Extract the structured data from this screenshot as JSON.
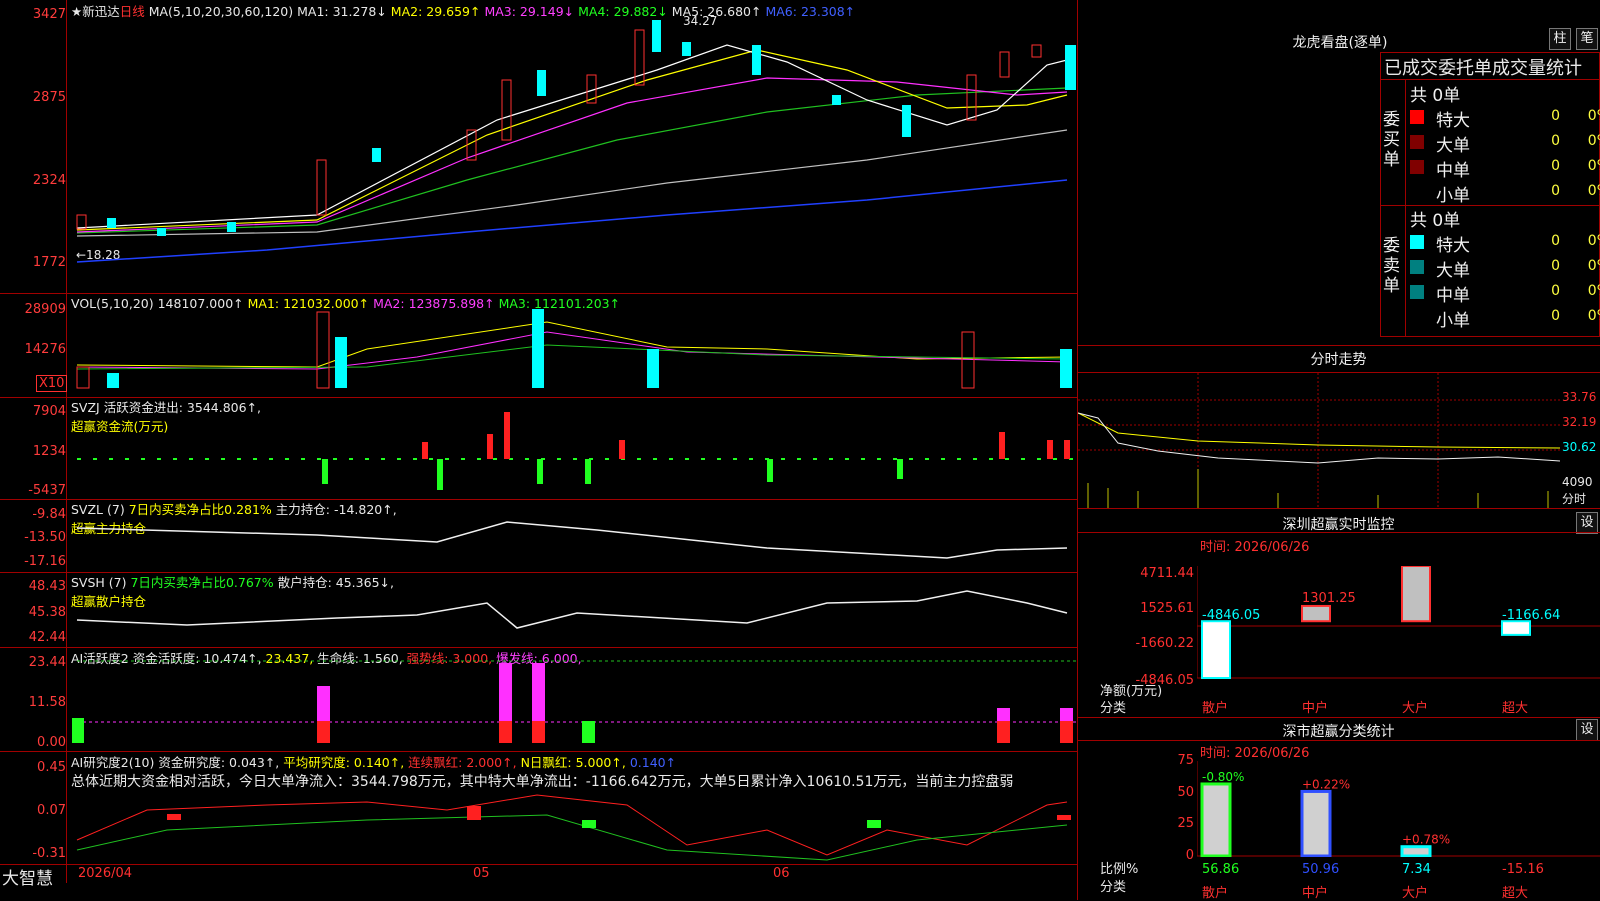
{
  "main_chart": {
    "title": "★新迅达",
    "period": "日线",
    "ma_params": "MA(5,10,20,30,60,120)",
    "ma": [
      {
        "t": "MA1: 31.278↓",
        "c": "w"
      },
      {
        "t": "MA2: 29.659↑",
        "c": "y"
      },
      {
        "t": "MA3: 29.149↓",
        "c": "m"
      },
      {
        "t": "MA4: 29.882↓",
        "c": "g"
      },
      {
        "t": "MA5: 26.680↑",
        "c": "w"
      },
      {
        "t": "MA6: 23.308↑",
        "c": "b"
      }
    ],
    "high_label": "34.27",
    "low_label": "←18.28",
    "axis": [
      "3427",
      "2875",
      "2324",
      "1772"
    ]
  },
  "vol": {
    "title": "VOL(5,10,20)",
    "value": "148107.000↑",
    "ma1": "MA1: 121032.000↑",
    "ma2": "MA2: 123875.898↑",
    "ma3": "MA3: 112101.203↑",
    "axis": [
      "28909",
      "14276"
    ],
    "unit": "X10"
  },
  "svzj": {
    "title": "SVZJ",
    "label": "活跃资金进出: 3544.806↑,",
    "sub": "超赢资金流(万元)",
    "axis": [
      "7904",
      "1234",
      "-5437"
    ]
  },
  "svzl": {
    "title": "SVZL (7)",
    "pct": "7日内买卖净占比0.281%",
    "hold": "主力持仓: -14.820↑,",
    "sub": "超赢主力持仓",
    "axis": [
      "-9.84",
      "-13.50",
      "-17.16"
    ]
  },
  "svsh": {
    "title": "SVSH (7)",
    "pct": "7日内买卖净占比0.767%",
    "hold": "散户持仓: 45.365↓,",
    "sub": "超赢散户持仓",
    "axis": [
      "48.43",
      "45.38",
      "42.44"
    ]
  },
  "ai1": {
    "title": "AI活跃度2",
    "a": "资金活跃度: 10.474↑,",
    "b": "23.437,",
    "c": "生命线: 1.560,",
    "d": "强势线: 3.000,",
    "e": "爆发线: 6.000,",
    "axis": [
      "23.44",
      "11.58",
      "0.00"
    ]
  },
  "ai2": {
    "title": "AI研究度2(10)",
    "a": "资金研究度: 0.043↑,",
    "b": "平均研究度: 0.140↑,",
    "c": "连续飘红: 2.000↑,",
    "d": "N日飘红: 5.000↑,",
    "e": "0.140↑",
    "note": "总体近期大资金相对活跃，今日大单净流入：3544.798万元，其中特大单净流出：-1166.642万元，大单5日累计净入10610.51万元，当前主力控盘弱",
    "axis": [
      "0.45",
      "0.07",
      "-0.31"
    ]
  },
  "footer": {
    "brand": "大智慧",
    "d1": "2026/04",
    "d2": "05",
    "d3": "06"
  },
  "lhb": {
    "title": "龙虎看盘(逐单)",
    "b1": "柱",
    "b2": "笔",
    "tabs": "已成交委托单成交量统计",
    "buy_side": "委买单",
    "sell_side": "委卖单",
    "buy_total": "共 0单",
    "sell_total": "共 0单",
    "rows": [
      {
        "n": "特大",
        "v": "0",
        "p": "0%"
      },
      {
        "n": "大单",
        "v": "0",
        "p": "0%"
      },
      {
        "n": "中单",
        "v": "0",
        "p": "0%"
      },
      {
        "n": "小单",
        "v": "0",
        "p": "0%"
      }
    ],
    "buy_colors": [
      "#ff0000",
      "#800000",
      "#800000",
      "#000000"
    ],
    "sell_colors": [
      "#00ffff",
      "#008080",
      "#008080",
      "#000000"
    ]
  },
  "intraday": {
    "title": "分时走势",
    "axis": [
      "33.76",
      "32.19",
      "30.62"
    ],
    "vol_axis": [
      "4090",
      "分时"
    ]
  },
  "sz_monitor": {
    "title": "深圳超赢实时监控",
    "btn": "设",
    "time": "时间: 2026/06/26",
    "axis": [
      "4711.44",
      "1525.61",
      "-1660.22",
      "-4846.05"
    ],
    "ylabel": "净额(万元)",
    "xlabel": "分类",
    "chart_data": {
      "type": "bar",
      "categories": [
        "散户",
        "中户",
        "大户",
        "超大"
      ],
      "values": [
        -4846.05,
        1301.25,
        4711.44,
        -1166.64
      ],
      "ylim": [
        -4846.05,
        4711.44
      ]
    }
  },
  "sz_class": {
    "title": "深市超赢分类统计",
    "btn": "设",
    "time": "时间: 2026/06/26",
    "axis": [
      "75",
      "50",
      "25",
      "0"
    ],
    "ylabel": "比例%",
    "xlabel": "分类",
    "chart_data": {
      "type": "bar",
      "categories": [
        "散户",
        "中户",
        "大户",
        "超大"
      ],
      "values": [
        56.86,
        50.96,
        7.34,
        -15.16
      ],
      "changes": [
        "-0.80%",
        "+0.22%",
        "+0.78%",
        ""
      ],
      "ylim": [
        0,
        75
      ]
    }
  }
}
